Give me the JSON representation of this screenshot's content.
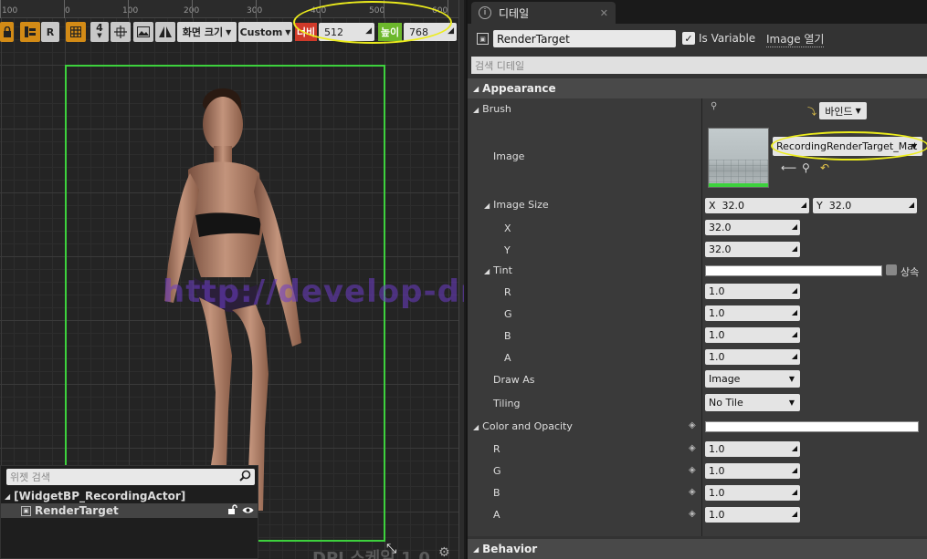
{
  "ruler": {
    "ticks": [
      "100",
      "0",
      "100",
      "200",
      "300",
      "400",
      "500",
      "600"
    ]
  },
  "toolbar": {
    "lock_icon": "lock-icon",
    "anchor_label": "R",
    "grid_snap_value": "4",
    "screen_size_label": "화면 크기",
    "custom_label": "Custom",
    "width_label": "너비",
    "width_value": "512",
    "height_label": "높이",
    "height_value": "768"
  },
  "canvas": {
    "frame_color": "#3dd13d",
    "dpi_label": "DPI 스케일 1.0",
    "watermark": "http://develop-dream.tistory.com/"
  },
  "hierarchy": {
    "search_placeholder": "위젯 검색",
    "root_label": "[WidgetBP_RecordingActor]",
    "child_label": "RenderTarget"
  },
  "details": {
    "tab_label": "디테일",
    "name_value": "RenderTarget",
    "is_variable_label": "Is Variable",
    "is_variable_checked": true,
    "image_open_label": "Image 열기",
    "search_placeholder": "검색 디테일",
    "categories": {
      "appearance": "Appearance",
      "color_opacity": "Color and Opacity",
      "behavior": "Behavior"
    },
    "brush": {
      "label": "Brush",
      "bind_label": "바인드",
      "image_label": "Image",
      "asset_name": "RecordingRenderTarget_Mat"
    },
    "image_size": {
      "label": "Image Size",
      "x_label": "X",
      "x_value": "32.0",
      "y_label": "Y",
      "y_value": "32.0",
      "x_row_label": "X",
      "y_row_label": "Y"
    },
    "tint": {
      "label": "Tint",
      "inherit_label": "상속",
      "r_label": "R",
      "r": "1.0",
      "g_label": "G",
      "g": "1.0",
      "b_label": "B",
      "b": "1.0",
      "a_label": "A",
      "a": "1.0"
    },
    "draw_as": {
      "label": "Draw As",
      "value": "Image"
    },
    "tiling": {
      "label": "Tiling",
      "value": "No Tile"
    },
    "color_and_opacity": {
      "r_label": "R",
      "r": "1.0",
      "g_label": "G",
      "g": "1.0",
      "b_label": "B",
      "b": "1.0",
      "a_label": "A",
      "a": "1.0"
    }
  },
  "colors": {
    "highlight": "#ecec1c",
    "width_tag": "#d03a2a",
    "height_tag": "#6cb82c",
    "toolbar_orange": "#d38b16"
  }
}
